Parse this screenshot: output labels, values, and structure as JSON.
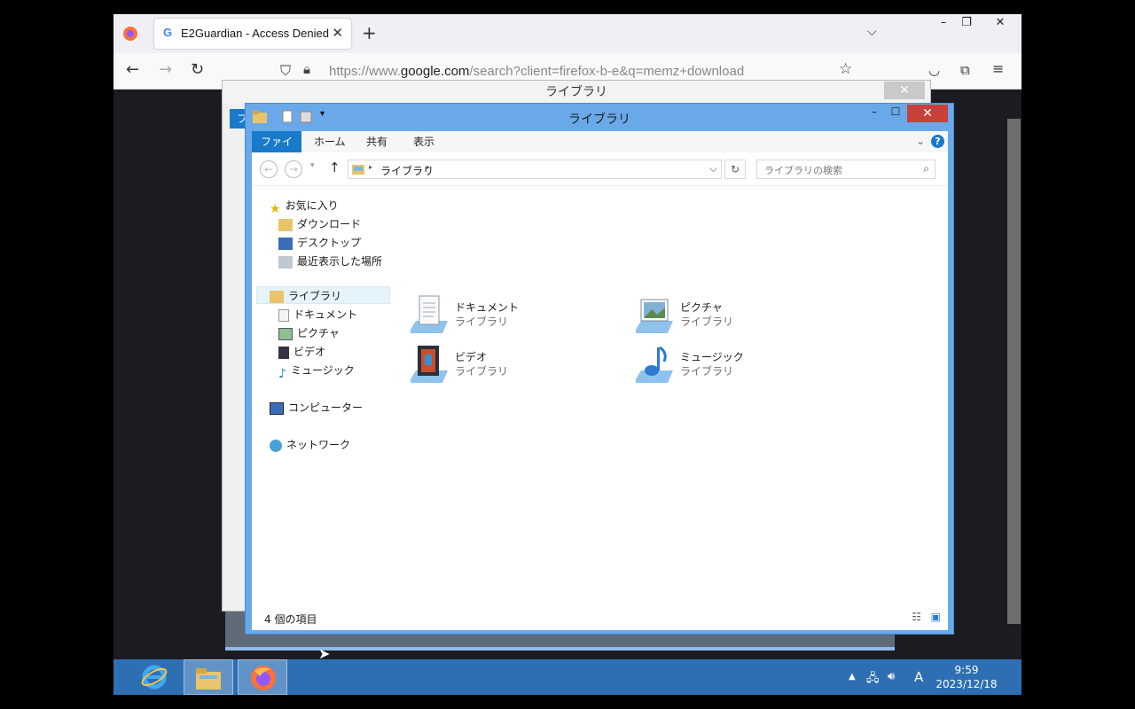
{
  "browser": {
    "tab_title": "E2Guardian - Access Denied",
    "tab_favicon": "G",
    "url_prefix": "https://www.",
    "url_domain": "google.com",
    "url_suffix": "/search?client=firefox-b-e&q=memz+download"
  },
  "back_window": {
    "title": "ライブラリ",
    "ribbon_first": "フ"
  },
  "explorer": {
    "title": "ライブラリ",
    "ribbon_tabs": [
      "ファイル",
      "ホーム",
      "共有",
      "表示"
    ],
    "breadcrumb": "ライブラリ",
    "search_placeholder": "ライブラリの検索",
    "nav": {
      "favorites": "お気に入り",
      "downloads": "ダウンロード",
      "desktop": "デスクトップ",
      "recent": "最近表示した場所",
      "libraries": "ライブラリ",
      "documents": "ドキュメント",
      "pictures": "ピクチャ",
      "videos": "ビデオ",
      "music": "ミュージック",
      "computer": "コンピューター",
      "network": "ネットワーク"
    },
    "items": [
      {
        "name": "ドキュメント",
        "sub": "ライブラリ"
      },
      {
        "name": "ピクチャ",
        "sub": "ライブラリ"
      },
      {
        "name": "ビデオ",
        "sub": "ライブラリ"
      },
      {
        "name": "ミュージック",
        "sub": "ライブラリ"
      }
    ],
    "status": "4 個の項目"
  },
  "taskbar": {
    "time": "9:59",
    "date": "2023/12/18",
    "ime": "A"
  }
}
